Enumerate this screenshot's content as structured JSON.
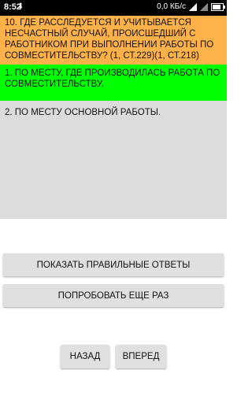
{
  "status_bar": {
    "time": "8:52",
    "download_icon": "download-arrow-icon",
    "speed": "0,0 КБ/с",
    "battery_level": 0.8
  },
  "question": {
    "text": "10. ГДЕ РАССЛЕДУЕТСЯ И УЧИТЫВАЕТСЯ НЕСЧАСТНЫЙ СЛУЧАЙ, ПРОИСШЕДШИЙ С РАБОТНИКОМ ПРИ ВЫПОЛНЕНИИ РАБОТЫ ПО СОВМЕСТИТЕЛЬСТВУ? (1, ст.229)(1, ст.218)",
    "background": "#ffb24a"
  },
  "answers": [
    {
      "text": "1. ПО МЕСТУ, ГДЕ ПРОИЗВОДИЛАСЬ РАБОТА ПО СОВМЕСТИТЕЛЬСТВУ.",
      "state": "correct",
      "background": "#00ff00"
    },
    {
      "text": "2. ПО МЕСТУ ОСНОВНОЙ РАБОТЫ.",
      "state": "neutral",
      "background": "#dcdcdc"
    }
  ],
  "buttons": {
    "show_answers": "ПОКАЗАТЬ ПРАВИЛЬНЫЕ ОТВЕТЫ",
    "try_again": "ПОПРОБОВАТЬ ЕЩЕ РАЗ",
    "back": "НАЗАД",
    "forward": "ВПЕРЕД"
  }
}
